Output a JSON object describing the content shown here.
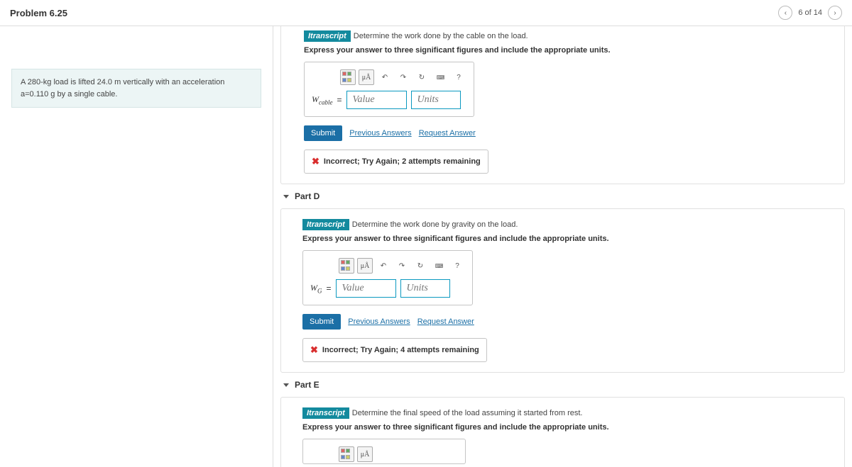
{
  "header": {
    "title": "Problem 6.25",
    "position": "6 of 14"
  },
  "prompt": "A 280-kg load is lifted 24.0 m vertically with an acceleration a=0.110 g by a single cable.",
  "transcript_label": "Itranscript",
  "partC": {
    "question": "Determine the work done by the cable on the load.",
    "instruction": "Express your answer to three significant figures and include the appropriate units.",
    "var_html": "W<sub>cable</sub>",
    "value_ph": "Value",
    "units_ph": "Units",
    "submit": "Submit",
    "prev": "Previous Answers",
    "req": "Request Answer",
    "feedback": "Incorrect; Try Again; 2 attempts remaining"
  },
  "partD": {
    "title": "Part D",
    "question": "Determine the work done by gravity on the load.",
    "instruction": "Express your answer to three significant figures and include the appropriate units.",
    "var_html": "W<sub>G</sub>",
    "value_ph": "Value",
    "units_ph": "Units",
    "submit": "Submit",
    "prev": "Previous Answers",
    "req": "Request Answer",
    "feedback": "Incorrect; Try Again; 4 attempts remaining"
  },
  "partE": {
    "title": "Part E",
    "question": "Determine the final speed of the load assuming it started from rest.",
    "instruction": "Express your answer to three significant figures and include the appropriate units."
  },
  "toolbar": {
    "ua": "μÅ",
    "help": "?"
  }
}
